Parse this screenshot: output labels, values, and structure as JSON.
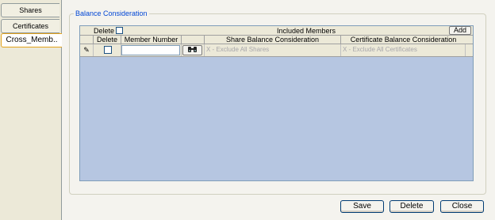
{
  "tabs": [
    {
      "label": "Shares",
      "underline_char": "S"
    },
    {
      "label": "Certificates",
      "underline_char": "e"
    },
    {
      "label": "Cross_Memb..",
      "underline_char": "_"
    }
  ],
  "group": {
    "title": "Balance Consideration"
  },
  "grid": {
    "toolbar": {
      "delete_label": "Delete",
      "title": "Included Members",
      "add_label": "Add"
    },
    "columns": [
      "Delete",
      "Member Number",
      "Share Balance Consideration",
      "Certificate Balance Consideration"
    ],
    "rows": [
      {
        "indicator": "✎",
        "member_number": "",
        "share_balance": "X - Exclude All Shares",
        "certificate_balance": "X - Exclude All Certificates"
      }
    ]
  },
  "buttons": {
    "save": "Save",
    "delete": "Delete",
    "close": "Close"
  }
}
